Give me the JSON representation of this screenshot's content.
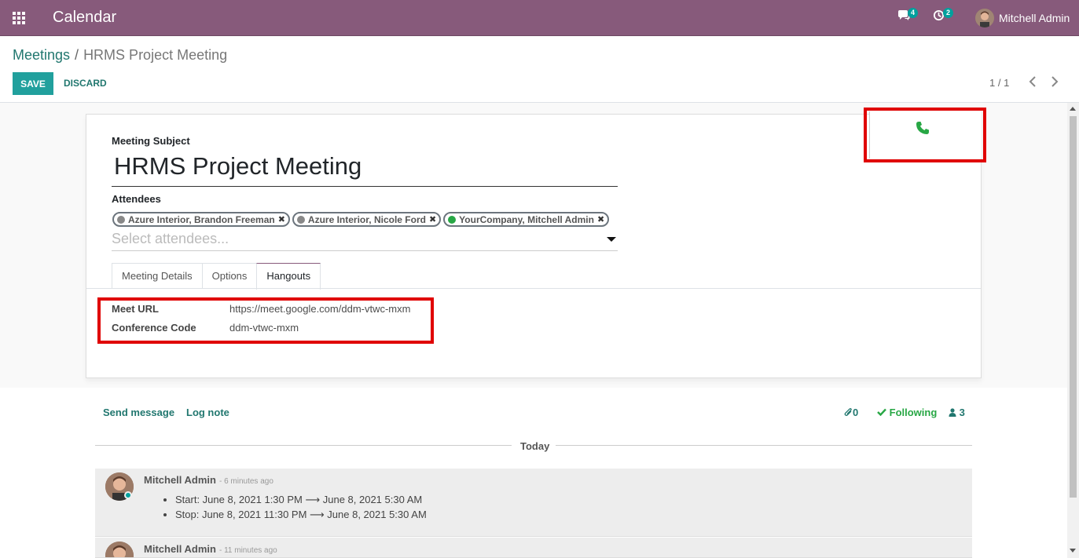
{
  "topbar": {
    "app_title": "Calendar",
    "messages_count": "4",
    "activities_count": "2",
    "user_name": "Mitchell Admin",
    "color": "#875a7b"
  },
  "breadcrumb": {
    "parent": "Meetings",
    "separator": "/",
    "current": "HRMS Project Meeting"
  },
  "toolbar": {
    "save_label": "SAVE",
    "discard_label": "DISCARD",
    "pager": "1 / 1"
  },
  "form": {
    "subject_label": "Meeting Subject",
    "subject_value": "HRMS Project Meeting",
    "attendees_label": "Attendees",
    "attendees": [
      {
        "name": "Azure Interior, Brandon Freeman",
        "status": "grey"
      },
      {
        "name": "Azure Interior, Nicole Ford",
        "status": "grey"
      },
      {
        "name": "YourCompany, Mitchell Admin",
        "status": "green"
      }
    ],
    "attendees_placeholder": "Select attendees...",
    "tabs": [
      "Meeting Details",
      "Options",
      "Hangouts"
    ],
    "active_tab": "Hangouts",
    "meet_url_label": "Meet URL",
    "meet_url_value": "https://meet.google.com/ddm-vtwc-mxm",
    "conference_code_label": "Conference Code",
    "conference_code_value": "ddm-vtwc-mxm"
  },
  "chatter": {
    "send_message": "Send message",
    "log_note": "Log note",
    "attachments_count": "0",
    "following_label": "Following",
    "followers_count": "3",
    "today_label": "Today",
    "messages": [
      {
        "author": "Mitchell Admin",
        "time": "- 6 minutes ago",
        "items": [
          "Start: June 8, 2021 1:30 PM ⟶ June 8, 2021 5:30 AM",
          "Stop: June 8, 2021 11:30 PM ⟶ June 8, 2021 5:30 AM"
        ]
      },
      {
        "author": "Mitchell Admin",
        "time": "- 11 minutes ago",
        "items": []
      }
    ]
  }
}
